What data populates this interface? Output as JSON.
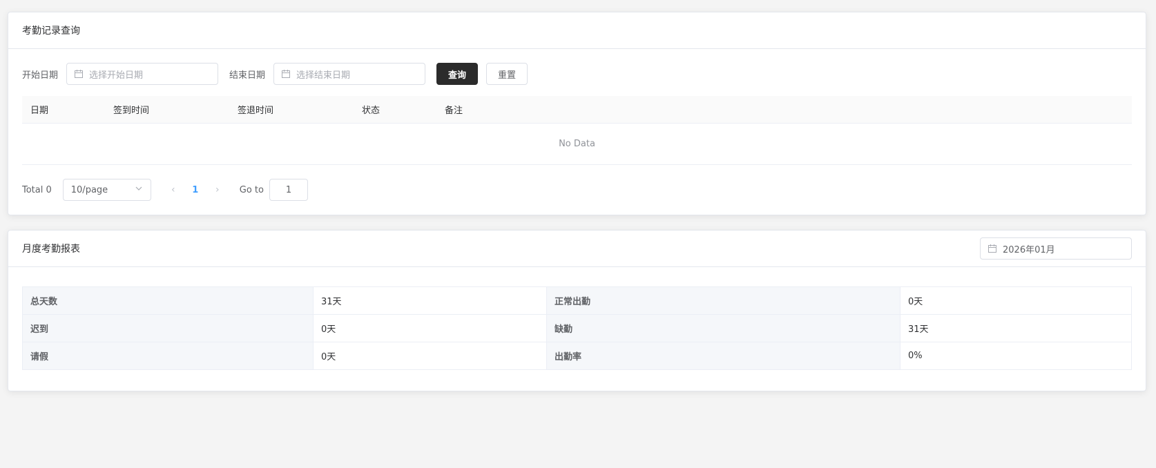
{
  "query_card": {
    "title": "考勤记录查询",
    "start_label": "开始日期",
    "start_placeholder": "选择开始日期",
    "end_label": "结束日期",
    "end_placeholder": "选择结束日期",
    "query_button": "查询",
    "reset_button": "重置",
    "columns": [
      "日期",
      "签到时间",
      "签退时间",
      "状态",
      "备注"
    ],
    "empty_text": "No Data",
    "pagination": {
      "total": "Total 0",
      "page_size": "10/page",
      "current_page": "1",
      "goto_label": "Go to",
      "goto_value": "1"
    }
  },
  "report_card": {
    "title": "月度考勤报表",
    "month_value": "2026年01月",
    "rows": [
      {
        "label1": "总天数",
        "value1": "31天",
        "label2": "正常出勤",
        "value2": "0天"
      },
      {
        "label1": "迟到",
        "value1": "0天",
        "label2": "缺勤",
        "value2": "31天"
      },
      {
        "label1": "请假",
        "value1": "0天",
        "label2": "出勤率",
        "value2": "0%"
      }
    ]
  }
}
